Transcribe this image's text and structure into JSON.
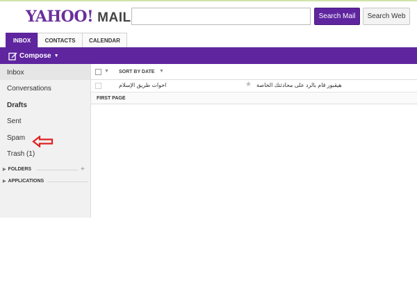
{
  "header": {
    "logo_yahoo": "YAHOO!",
    "logo_mail": "MAIL",
    "search_value": "",
    "search_mail_label": "Search Mail",
    "search_web_label": "Search Web"
  },
  "tabs": [
    {
      "label": "INBOX",
      "active": true
    },
    {
      "label": "CONTACTS",
      "active": false
    },
    {
      "label": "CALENDAR",
      "active": false
    }
  ],
  "toolbar": {
    "compose_label": "Compose"
  },
  "sidebar": {
    "items": [
      {
        "label": "Inbox",
        "selected": true
      },
      {
        "label": "Conversations"
      },
      {
        "label": "Drafts",
        "bold": true
      },
      {
        "label": "Sent"
      },
      {
        "label": "Spam"
      },
      {
        "label": "Trash (1)"
      }
    ],
    "folders_label": "FOLDERS",
    "applications_label": "APPLICATIONS"
  },
  "list": {
    "sort_label": "SORT BY DATE",
    "messages": [
      {
        "sender": "اخوات طريق الإسلام",
        "subject": "هيقبور قام بالرد على محادثتك الخاصة",
        "starred": false
      }
    ],
    "first_page_label": "FIRST PAGE"
  },
  "colors": {
    "brand_purple": "#5f259f",
    "annotation_red": "#e02020"
  },
  "icons": {
    "compose": "pencil-square-icon",
    "star": "star-icon",
    "annotation": "red-arrow-icon"
  }
}
